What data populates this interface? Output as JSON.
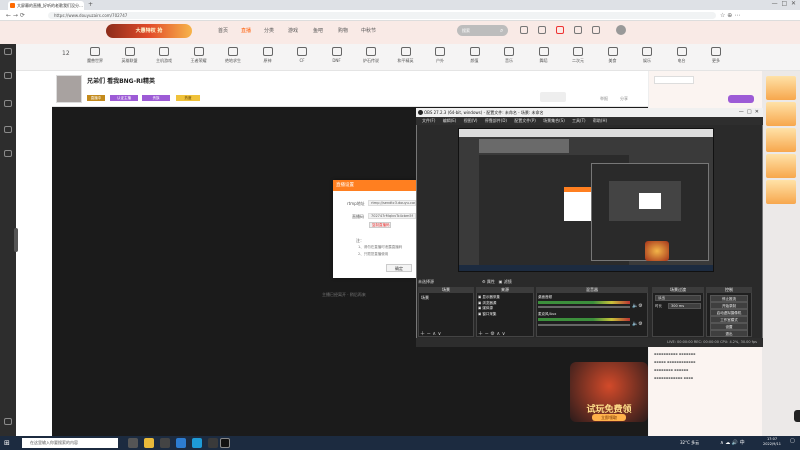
{
  "browser": {
    "tab_title": "大屏幕的直播_好听的老歌我们没分…",
    "url": "https://www.douyuzairs.com/702747"
  },
  "site": {
    "promo_text": "大惠特权 抢",
    "nav": [
      "首页",
      "直播",
      "分类",
      "游戏",
      "鱼吧",
      "购物",
      "中秋节"
    ],
    "search_placeholder": "搜索",
    "categories": [
      "魔兽世界",
      "英雄联盟",
      "主机游戏",
      "王者荣耀",
      "绝地求生",
      "原神",
      "CF",
      "DNF",
      "炉石传说",
      "和平精英",
      "户外",
      "颜值",
      "音乐",
      "舞蹈",
      "二次元",
      "美食",
      "娱乐",
      "电台",
      "更多"
    ]
  },
  "room": {
    "level": "12",
    "title": "兄弟们 看我BNG-RI精英",
    "tags": [
      "直播中",
      "认证主播",
      "贵族",
      "热度"
    ],
    "report": "举报",
    "share": "分享"
  },
  "dialog": {
    "title": "直播设置",
    "rtmp_label": "rtmp地址",
    "rtmp_value": "rtmp://sendtc3.douyu.com/live",
    "key_label": "直播码",
    "key_value": "702747rMqlvvTc4cbm5f",
    "key_badge": "复制直播码",
    "notice_label": "注：",
    "notice_1": "1、请勿在直播时泄露直播码",
    "notice_2": "2、只限您直播使用",
    "ok_button": "确定"
  },
  "obs": {
    "title": "OBS 27.2.3 (64-bit, windows) - 配置文件: 未命名 - 场景: 未命名",
    "menu": [
      "文件(F)",
      "编辑(E)",
      "视图(V)",
      "停靠部件(D)",
      "配置文件(P)",
      "场景集合(S)",
      "工具(T)",
      "帮助(H)"
    ],
    "scene_label": "未选择源",
    "docks": {
      "scenes": "场景",
      "sources": "来源",
      "mixer": "混音器",
      "transitions": "场景过渡",
      "controls": "控制"
    },
    "scenes_list": [
      "场景"
    ],
    "sources_list": [
      "显示器采集",
      "浏览器源",
      "媒体源",
      "窗口采集"
    ],
    "mixer_tracks": [
      "桌面音频",
      "麦克风/Aux"
    ],
    "transition_value": "淡出",
    "duration_label": "时长",
    "duration_value": "300 ms",
    "controls": [
      "停止推流",
      "开始录制",
      "启动虚拟摄像机",
      "工作室模式",
      "设置",
      "退出"
    ],
    "status": "LIVE: 00:00:00   REC: 00:00:00   CPU: 4.2%, 30.00 fps"
  },
  "chat": {
    "ad_title": "试玩免费领",
    "ad_button": "立即领取"
  },
  "taskbar": {
    "search_placeholder": "在这里输入你要搜索的内容",
    "weather": "32°C 多云",
    "time": "17:07",
    "date": "2022/9/11"
  },
  "colors": {
    "accent": "#ff7f20",
    "obs_bg": "#2a2a2a",
    "taskbar": "#1c2b40"
  }
}
